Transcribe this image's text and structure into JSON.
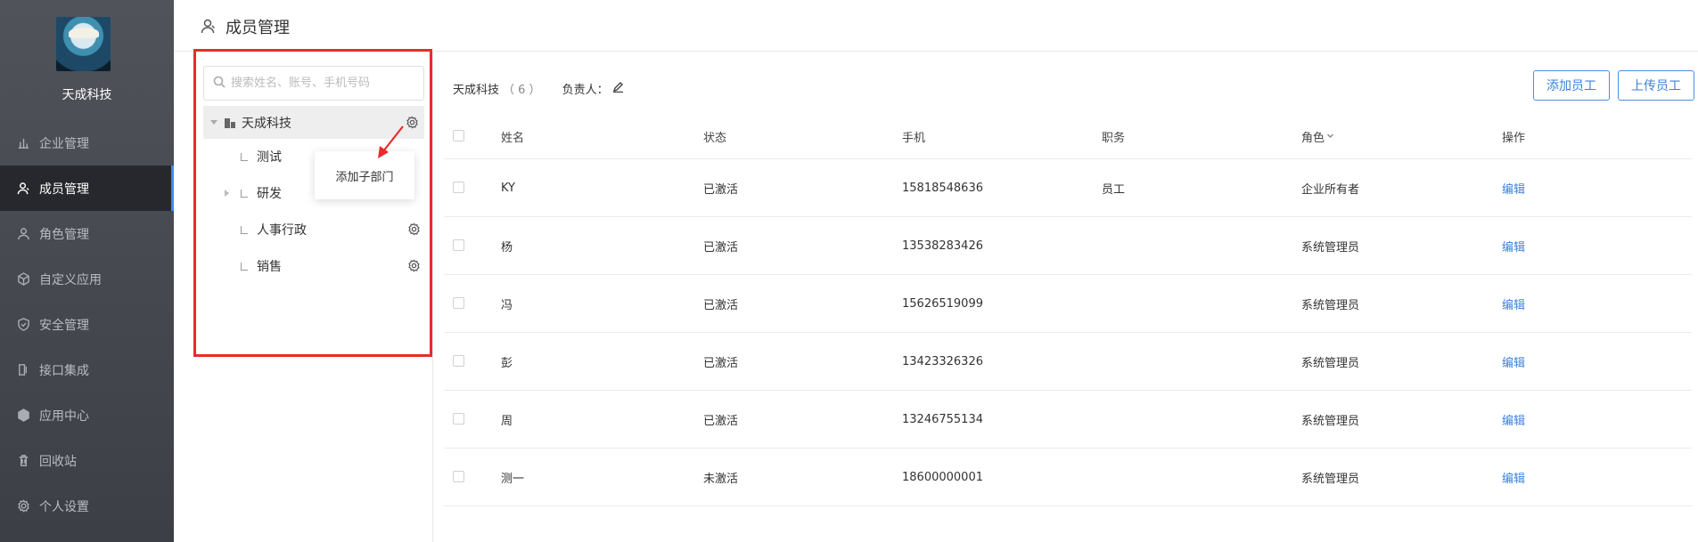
{
  "sidebar": {
    "org_name": "天成科技",
    "items": [
      {
        "label": "企业管理",
        "icon": "chart-icon"
      },
      {
        "label": "成员管理",
        "icon": "user-icon",
        "active": true
      },
      {
        "label": "角色管理",
        "icon": "role-icon"
      },
      {
        "label": "自定义应用",
        "icon": "cube-icon"
      },
      {
        "label": "安全管理",
        "icon": "shield-icon"
      },
      {
        "label": "接口集成",
        "icon": "plug-icon"
      },
      {
        "label": "应用中心",
        "icon": "box-icon"
      },
      {
        "label": "回收站",
        "icon": "trash-icon"
      },
      {
        "label": "个人设置",
        "icon": "gear-icon"
      }
    ]
  },
  "header": {
    "title": "成员管理"
  },
  "tree": {
    "search_placeholder": "搜索姓名、账号、手机号码",
    "root": "天成科技",
    "children": [
      "测试",
      "研发",
      "人事行政",
      "销售"
    ],
    "popover": "添加子部门"
  },
  "summary": {
    "org": "天成科技",
    "count": "（ 6 ）",
    "owner_label": "负责人："
  },
  "buttons": {
    "add": "添加员工",
    "upload": "上传员工"
  },
  "table": {
    "headers": {
      "name": "姓名",
      "status": "状态",
      "phone": "手机",
      "title": "职务",
      "role": "角色",
      "op": "操作"
    },
    "rows": [
      {
        "name": "KY",
        "status": "已激活",
        "phone": "15818548636",
        "title": "员工",
        "role": "企业所有者",
        "op": "编辑"
      },
      {
        "name": "杨",
        "status": "已激活",
        "phone": "13538283426",
        "title": "",
        "role": "系统管理员",
        "op": "编辑"
      },
      {
        "name": "冯",
        "status": "已激活",
        "phone": "15626519099",
        "title": "",
        "role": "系统管理员",
        "op": "编辑"
      },
      {
        "name": "彭",
        "status": "已激活",
        "phone": "13423326326",
        "title": "",
        "role": "系统管理员",
        "op": "编辑"
      },
      {
        "name": "周",
        "status": "已激活",
        "phone": "13246755134",
        "title": "",
        "role": "系统管理员",
        "op": "编辑"
      },
      {
        "name": "测一",
        "status": "未激活",
        "phone": "18600000001",
        "title": "",
        "role": "系统管理员",
        "op": "编辑"
      }
    ]
  }
}
